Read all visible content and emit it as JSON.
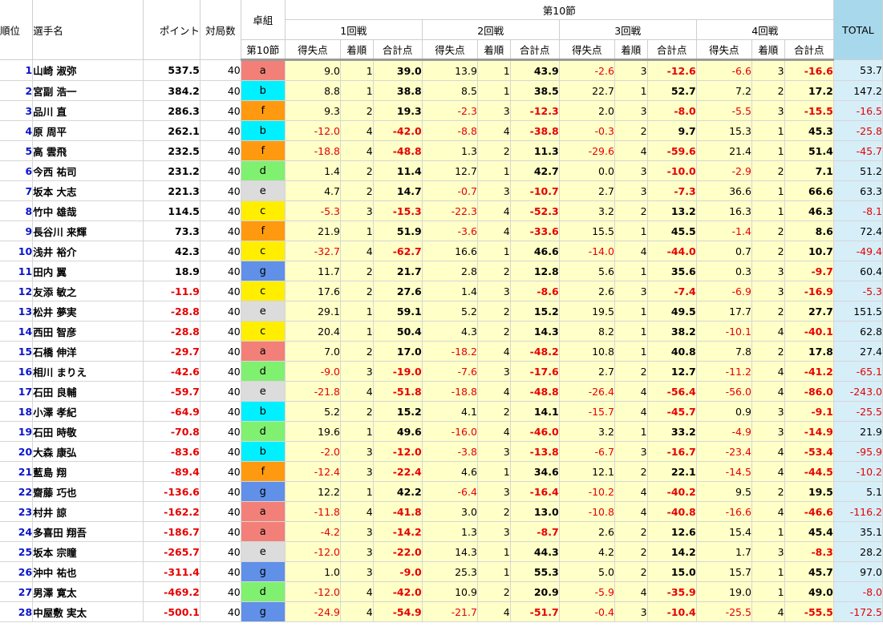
{
  "header": {
    "rank": "順位",
    "name": "選手名",
    "points": "ポイント",
    "games": "対局数",
    "table_group": "卓組",
    "section": "第10節",
    "section_sub": "第10節",
    "rounds": [
      "1回戦",
      "2回戦",
      "3回戦",
      "4回戦"
    ],
    "score": "得失点",
    "place": "着順",
    "sum": "合計点",
    "total": "TOTAL"
  },
  "table_colors": {
    "a": "#f28078",
    "b": "#00f0ff",
    "c": "#ffee00",
    "d": "#80f070",
    "e": "#dcdcdc",
    "f": "#ff9a10",
    "g": "#6090e8"
  },
  "rows": [
    {
      "rank": "1",
      "name": "山崎 淑弥",
      "points": "537.5",
      "games": "40",
      "table": "a",
      "r": [
        [
          "9.0",
          "1",
          "39.0"
        ],
        [
          "13.9",
          "1",
          "43.9"
        ],
        [
          "-2.6",
          "3",
          "-12.6"
        ],
        [
          "-6.6",
          "3",
          "-16.6"
        ]
      ],
      "total": "53.7"
    },
    {
      "rank": "2",
      "name": "宮副 浩一",
      "points": "384.2",
      "games": "40",
      "table": "b",
      "r": [
        [
          "8.8",
          "1",
          "38.8"
        ],
        [
          "8.5",
          "1",
          "38.5"
        ],
        [
          "22.7",
          "1",
          "52.7"
        ],
        [
          "7.2",
          "2",
          "17.2"
        ]
      ],
      "total": "147.2"
    },
    {
      "rank": "3",
      "name": "品川 直",
      "points": "286.3",
      "games": "40",
      "table": "f",
      "r": [
        [
          "9.3",
          "2",
          "19.3"
        ],
        [
          "-2.3",
          "3",
          "-12.3"
        ],
        [
          "2.0",
          "3",
          "-8.0"
        ],
        [
          "-5.5",
          "3",
          "-15.5"
        ]
      ],
      "total": "-16.5"
    },
    {
      "rank": "4",
      "name": "原 周平",
      "points": "262.1",
      "games": "40",
      "table": "b",
      "r": [
        [
          "-12.0",
          "4",
          "-42.0"
        ],
        [
          "-8.8",
          "4",
          "-38.8"
        ],
        [
          "-0.3",
          "2",
          "9.7"
        ],
        [
          "15.3",
          "1",
          "45.3"
        ]
      ],
      "total": "-25.8"
    },
    {
      "rank": "5",
      "name": "高 雲飛",
      "points": "232.5",
      "games": "40",
      "table": "f",
      "r": [
        [
          "-18.8",
          "4",
          "-48.8"
        ],
        [
          "1.3",
          "2",
          "11.3"
        ],
        [
          "-29.6",
          "4",
          "-59.6"
        ],
        [
          "21.4",
          "1",
          "51.4"
        ]
      ],
      "total": "-45.7"
    },
    {
      "rank": "6",
      "name": "今西 祐司",
      "points": "231.2",
      "games": "40",
      "table": "d",
      "r": [
        [
          "1.4",
          "2",
          "11.4"
        ],
        [
          "12.7",
          "1",
          "42.7"
        ],
        [
          "0.0",
          "3",
          "-10.0"
        ],
        [
          "-2.9",
          "2",
          "7.1"
        ]
      ],
      "total": "51.2"
    },
    {
      "rank": "7",
      "name": "坂本 大志",
      "points": "221.3",
      "games": "40",
      "table": "e",
      "r": [
        [
          "4.7",
          "2",
          "14.7"
        ],
        [
          "-0.7",
          "3",
          "-10.7"
        ],
        [
          "2.7",
          "3",
          "-7.3"
        ],
        [
          "36.6",
          "1",
          "66.6"
        ]
      ],
      "total": "63.3"
    },
    {
      "rank": "8",
      "name": "竹中 雄哉",
      "points": "114.5",
      "games": "40",
      "table": "c",
      "r": [
        [
          "-5.3",
          "3",
          "-15.3"
        ],
        [
          "-22.3",
          "4",
          "-52.3"
        ],
        [
          "3.2",
          "2",
          "13.2"
        ],
        [
          "16.3",
          "1",
          "46.3"
        ]
      ],
      "total": "-8.1"
    },
    {
      "rank": "9",
      "name": "長谷川 来輝",
      "points": "73.3",
      "games": "40",
      "table": "f",
      "r": [
        [
          "21.9",
          "1",
          "51.9"
        ],
        [
          "-3.6",
          "4",
          "-33.6"
        ],
        [
          "15.5",
          "1",
          "45.5"
        ],
        [
          "-1.4",
          "2",
          "8.6"
        ]
      ],
      "total": "72.4"
    },
    {
      "rank": "10",
      "name": "浅井 裕介",
      "points": "42.3",
      "games": "40",
      "table": "c",
      "r": [
        [
          "-32.7",
          "4",
          "-62.7"
        ],
        [
          "16.6",
          "1",
          "46.6"
        ],
        [
          "-14.0",
          "4",
          "-44.0"
        ],
        [
          "0.7",
          "2",
          "10.7"
        ]
      ],
      "total": "-49.4"
    },
    {
      "rank": "11",
      "name": "田内 翼",
      "points": "18.9",
      "games": "40",
      "table": "g",
      "r": [
        [
          "11.7",
          "2",
          "21.7"
        ],
        [
          "2.8",
          "2",
          "12.8"
        ],
        [
          "5.6",
          "1",
          "35.6"
        ],
        [
          "0.3",
          "3",
          "-9.7"
        ]
      ],
      "total": "60.4"
    },
    {
      "rank": "12",
      "name": "友添 敏之",
      "points": "-11.9",
      "games": "40",
      "table": "c",
      "r": [
        [
          "17.6",
          "2",
          "27.6"
        ],
        [
          "1.4",
          "3",
          "-8.6"
        ],
        [
          "2.6",
          "3",
          "-7.4"
        ],
        [
          "-6.9",
          "3",
          "-16.9"
        ]
      ],
      "total": "-5.3"
    },
    {
      "rank": "13",
      "name": "松井 夢実",
      "points": "-28.8",
      "games": "40",
      "table": "e",
      "r": [
        [
          "29.1",
          "1",
          "59.1"
        ],
        [
          "5.2",
          "2",
          "15.2"
        ],
        [
          "19.5",
          "1",
          "49.5"
        ],
        [
          "17.7",
          "2",
          "27.7"
        ]
      ],
      "total": "151.5"
    },
    {
      "rank": "14",
      "name": "西田 智彦",
      "points": "-28.8",
      "games": "40",
      "table": "c",
      "r": [
        [
          "20.4",
          "1",
          "50.4"
        ],
        [
          "4.3",
          "2",
          "14.3"
        ],
        [
          "8.2",
          "1",
          "38.2"
        ],
        [
          "-10.1",
          "4",
          "-40.1"
        ]
      ],
      "total": "62.8"
    },
    {
      "rank": "15",
      "name": "石橋 伸洋",
      "points": "-29.7",
      "games": "40",
      "table": "a",
      "r": [
        [
          "7.0",
          "2",
          "17.0"
        ],
        [
          "-18.2",
          "4",
          "-48.2"
        ],
        [
          "10.8",
          "1",
          "40.8"
        ],
        [
          "7.8",
          "2",
          "17.8"
        ]
      ],
      "total": "27.4"
    },
    {
      "rank": "16",
      "name": "相川 まりえ",
      "points": "-42.6",
      "games": "40",
      "table": "d",
      "r": [
        [
          "-9.0",
          "3",
          "-19.0"
        ],
        [
          "-7.6",
          "3",
          "-17.6"
        ],
        [
          "2.7",
          "2",
          "12.7"
        ],
        [
          "-11.2",
          "4",
          "-41.2"
        ]
      ],
      "total": "-65.1"
    },
    {
      "rank": "17",
      "name": "石田 良輔",
      "points": "-59.7",
      "games": "40",
      "table": "e",
      "r": [
        [
          "-21.8",
          "4",
          "-51.8"
        ],
        [
          "-18.8",
          "4",
          "-48.8"
        ],
        [
          "-26.4",
          "4",
          "-56.4"
        ],
        [
          "-56.0",
          "4",
          "-86.0"
        ]
      ],
      "total": "-243.0"
    },
    {
      "rank": "18",
      "name": "小澤 孝紀",
      "points": "-64.9",
      "games": "40",
      "table": "b",
      "r": [
        [
          "5.2",
          "2",
          "15.2"
        ],
        [
          "4.1",
          "2",
          "14.1"
        ],
        [
          "-15.7",
          "4",
          "-45.7"
        ],
        [
          "0.9",
          "3",
          "-9.1"
        ]
      ],
      "total": "-25.5"
    },
    {
      "rank": "19",
      "name": "石田 時敬",
      "points": "-70.8",
      "games": "40",
      "table": "d",
      "r": [
        [
          "19.6",
          "1",
          "49.6"
        ],
        [
          "-16.0",
          "4",
          "-46.0"
        ],
        [
          "3.2",
          "1",
          "33.2"
        ],
        [
          "-4.9",
          "3",
          "-14.9"
        ]
      ],
      "total": "21.9"
    },
    {
      "rank": "20",
      "name": "大森 康弘",
      "points": "-83.6",
      "games": "40",
      "table": "b",
      "r": [
        [
          "-2.0",
          "3",
          "-12.0"
        ],
        [
          "-3.8",
          "3",
          "-13.8"
        ],
        [
          "-6.7",
          "3",
          "-16.7"
        ],
        [
          "-23.4",
          "4",
          "-53.4"
        ]
      ],
      "total": "-95.9"
    },
    {
      "rank": "21",
      "name": "藍島 翔",
      "points": "-89.4",
      "games": "40",
      "table": "f",
      "r": [
        [
          "-12.4",
          "3",
          "-22.4"
        ],
        [
          "4.6",
          "1",
          "34.6"
        ],
        [
          "12.1",
          "2",
          "22.1"
        ],
        [
          "-14.5",
          "4",
          "-44.5"
        ]
      ],
      "total": "-10.2"
    },
    {
      "rank": "22",
      "name": "齋藤 巧也",
      "points": "-136.6",
      "games": "40",
      "table": "g",
      "r": [
        [
          "12.2",
          "1",
          "42.2"
        ],
        [
          "-6.4",
          "3",
          "-16.4"
        ],
        [
          "-10.2",
          "4",
          "-40.2"
        ],
        [
          "9.5",
          "2",
          "19.5"
        ]
      ],
      "total": "5.1"
    },
    {
      "rank": "23",
      "name": "村井 諒",
      "points": "-162.2",
      "games": "40",
      "table": "a",
      "r": [
        [
          "-11.8",
          "4",
          "-41.8"
        ],
        [
          "3.0",
          "2",
          "13.0"
        ],
        [
          "-10.8",
          "4",
          "-40.8"
        ],
        [
          "-16.6",
          "4",
          "-46.6"
        ]
      ],
      "total": "-116.2"
    },
    {
      "rank": "24",
      "name": "多喜田 翔吾",
      "points": "-186.7",
      "games": "40",
      "table": "a",
      "r": [
        [
          "-4.2",
          "3",
          "-14.2"
        ],
        [
          "1.3",
          "3",
          "-8.7"
        ],
        [
          "2.6",
          "2",
          "12.6"
        ],
        [
          "15.4",
          "1",
          "45.4"
        ]
      ],
      "total": "35.1"
    },
    {
      "rank": "25",
      "name": "坂本 宗瞳",
      "points": "-265.7",
      "games": "40",
      "table": "e",
      "r": [
        [
          "-12.0",
          "3",
          "-22.0"
        ],
        [
          "14.3",
          "1",
          "44.3"
        ],
        [
          "4.2",
          "2",
          "14.2"
        ],
        [
          "1.7",
          "3",
          "-8.3"
        ]
      ],
      "total": "28.2"
    },
    {
      "rank": "26",
      "name": "沖中 祐也",
      "points": "-311.4",
      "games": "40",
      "table": "g",
      "r": [
        [
          "1.0",
          "3",
          "-9.0"
        ],
        [
          "25.3",
          "1",
          "55.3"
        ],
        [
          "5.0",
          "2",
          "15.0"
        ],
        [
          "15.7",
          "1",
          "45.7"
        ]
      ],
      "total": "97.0"
    },
    {
      "rank": "27",
      "name": "男澤 寛太",
      "points": "-469.2",
      "games": "40",
      "table": "d",
      "r": [
        [
          "-12.0",
          "4",
          "-42.0"
        ],
        [
          "10.9",
          "2",
          "20.9"
        ],
        [
          "-5.9",
          "4",
          "-35.9"
        ],
        [
          "19.0",
          "1",
          "49.0"
        ]
      ],
      "total": "-8.0"
    },
    {
      "rank": "28",
      "name": "中屋敷 実太",
      "points": "-500.1",
      "games": "40",
      "table": "g",
      "r": [
        [
          "-24.9",
          "4",
          "-54.9"
        ],
        [
          "-21.7",
          "4",
          "-51.7"
        ],
        [
          "-0.4",
          "3",
          "-10.4"
        ],
        [
          "-25.5",
          "4",
          "-55.5"
        ]
      ],
      "total": "-172.5"
    }
  ]
}
